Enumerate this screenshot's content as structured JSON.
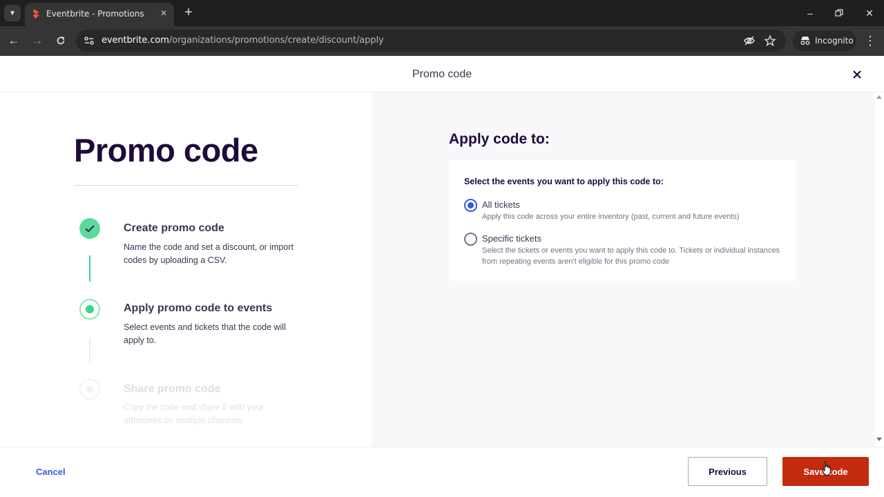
{
  "browser": {
    "tab_title": "Eventbrite - Promotions",
    "url_host": "eventbrite.com",
    "url_path": "/organizations/promotions/create/discount/apply",
    "incognito_label": "Incognito"
  },
  "modal": {
    "title": "Promo code"
  },
  "left": {
    "heading": "Promo code",
    "steps": [
      {
        "title": "Create promo code",
        "description": "Name the code and set a discount, or import codes by uploading a CSV.",
        "status": "complete"
      },
      {
        "title": "Apply promo code to events",
        "description": "Select events and tickets that the code will apply to.",
        "status": "current"
      },
      {
        "title": "Share promo code",
        "description": "Copy the code and share it with your attendees on multiple channels",
        "status": "upcoming"
      }
    ]
  },
  "right": {
    "heading": "Apply code to:",
    "card_label": "Select the events you want to apply this code to:",
    "options": [
      {
        "label": "All tickets",
        "description": "Apply this code across your entire inventory (past, current and future events)",
        "selected": true
      },
      {
        "label": "Specific tickets",
        "description": "Select the tickets or events you want to apply this code to. Tickets or individual instances from repeating events aren't eligible for this promo code",
        "selected": false
      }
    ]
  },
  "footer": {
    "cancel_label": "Cancel",
    "previous_label": "Previous",
    "save_label": "Save code"
  },
  "colors": {
    "primary_action": "#c42a0d",
    "link_blue": "#3659e3",
    "step_green": "#3ed589",
    "heading_dark": "#1e0a3c"
  }
}
